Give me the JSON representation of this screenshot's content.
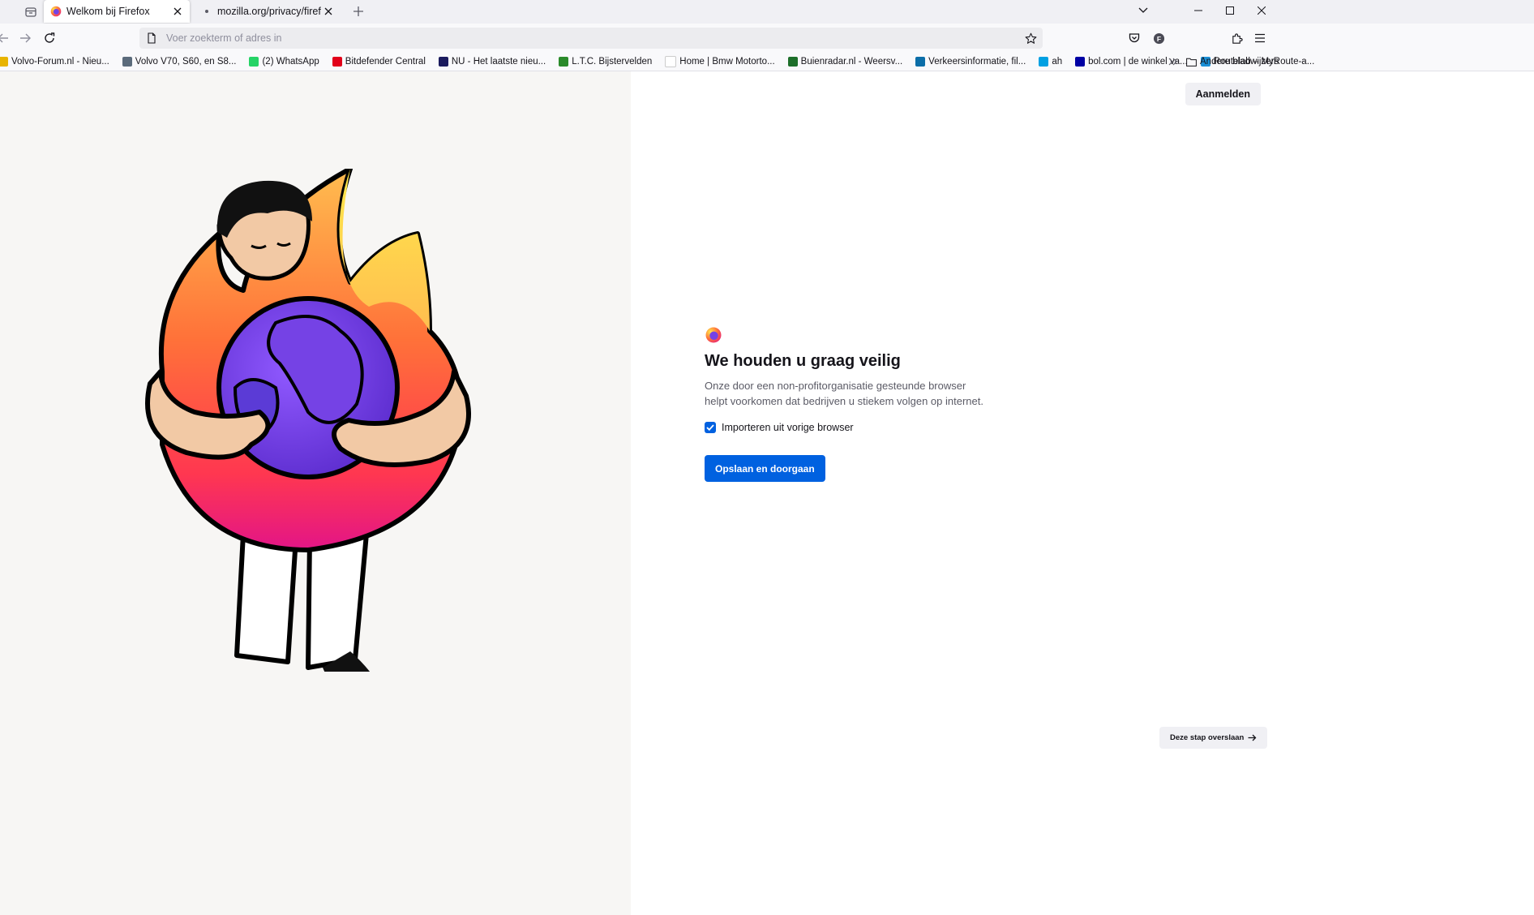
{
  "tabs": [
    {
      "title": "Welkom bij Firefox",
      "active": true
    },
    {
      "title": "mozilla.org/privacy/firefox/",
      "active": false
    }
  ],
  "urlbar": {
    "placeholder": "Voer zoekterm of adres in",
    "value": ""
  },
  "bookmarks": [
    {
      "label": "Volvo-Forum.nl - Nieu...",
      "icon": "volvo-forum-icon",
      "color": "#e8b400"
    },
    {
      "label": "Volvo V70, S60, en S8...",
      "icon": "volvo-icon",
      "color": "#5b6b7b"
    },
    {
      "label": "(2) WhatsApp",
      "icon": "whatsapp-icon",
      "color": "#25d366"
    },
    {
      "label": "Bitdefender Central",
      "icon": "bitdefender-icon",
      "color": "#e2001a"
    },
    {
      "label": "NU - Het laatste nieu...",
      "icon": "nu-icon",
      "color": "#1b1b5e"
    },
    {
      "label": "L.T.C. Bijstervelden",
      "icon": "ltc-icon",
      "color": "#2a8a2a"
    },
    {
      "label": "Home | Bmw Motorto...",
      "icon": "bmw-icon",
      "color": "#ffffff"
    },
    {
      "label": "Buienradar.nl - Weersv...",
      "icon": "buienradar-icon",
      "color": "#1d6f2a"
    },
    {
      "label": "Verkeersinformatie, fil...",
      "icon": "verkeer-icon",
      "color": "#0b6ea8"
    },
    {
      "label": "ah",
      "icon": "ah-icon",
      "color": "#00a0e2"
    },
    {
      "label": "bol.com | de winkel va...",
      "icon": "bol-icon",
      "color": "#0000a4"
    },
    {
      "label": "Routelab – MyRoute-a...",
      "icon": "routelab-icon",
      "color": "#1a8fd6"
    }
  ],
  "bookmarks_other": "Andere bladwijzers",
  "signin_label": "Aanmelden",
  "welcome": {
    "heading": "We houden u graag veilig",
    "subtitle": "Onze door een non-profitorganisatie gesteunde browser helpt voorkomen dat bedrijven u stiekem volgen op internet.",
    "import_label": "Importeren uit vorige browser",
    "import_checked": true,
    "primary_label": "Opslaan en doorgaan",
    "skip_label": "Deze stap overslaan"
  },
  "colors": {
    "accent": "#0061e0",
    "left_bg": "#f7f6f4"
  }
}
